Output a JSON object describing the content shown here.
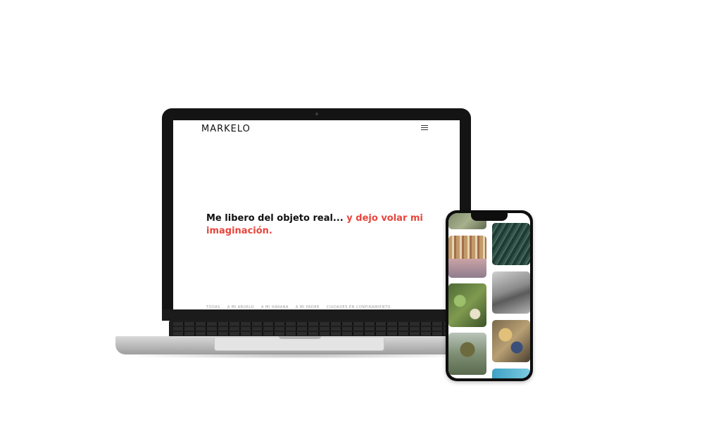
{
  "laptop": {
    "site": {
      "logo": "MARKELO",
      "menu_icon": "hamburger-menu-icon",
      "headline": {
        "plain": "Me libero del objeto real...",
        "accent": "y dejo volar mi imaginación.",
        "accent_color": "#e8453c"
      },
      "filters": [
        "TODAS",
        "A MI ABUELO",
        "A MI HARANA",
        "A MI PADRE",
        "CIUDADES EN CONFINAMIENTO"
      ]
    }
  },
  "phone": {
    "gallery_tiles": [
      "painting-1",
      "painting-2",
      "painting-3",
      "painting-4",
      "painting-5",
      "painting-6",
      "painting-7",
      "painting-8"
    ]
  }
}
